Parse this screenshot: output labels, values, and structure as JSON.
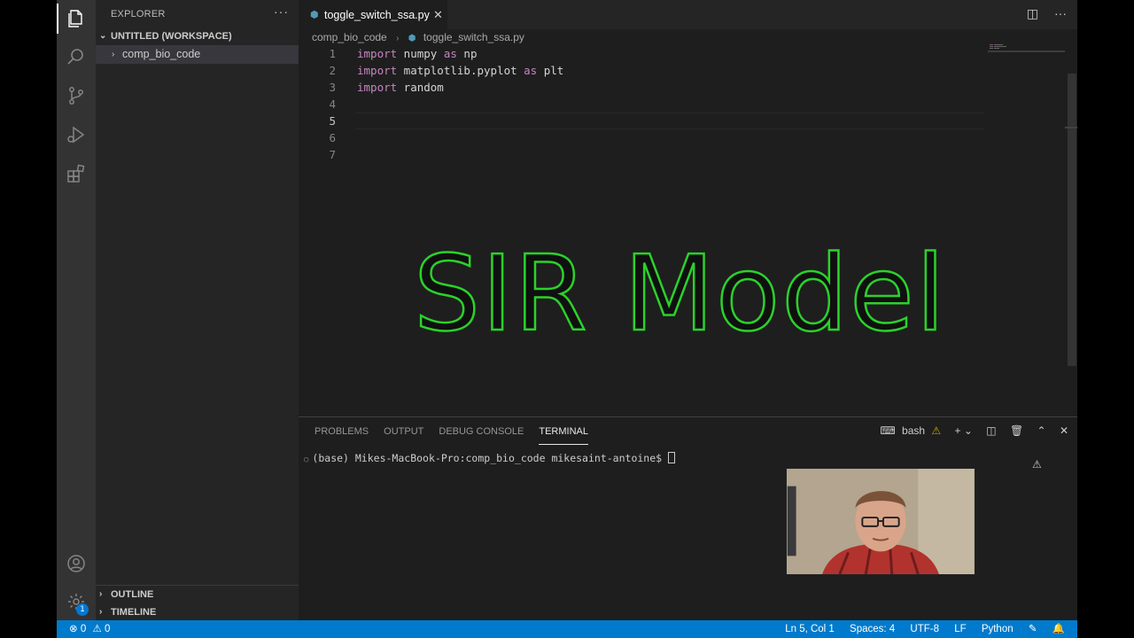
{
  "sidebar": {
    "title": "EXPLORER",
    "more": "···",
    "workspace_label": "UNTITLED (WORKSPACE)",
    "folder_label": "comp_bio_code",
    "outline_label": "OUTLINE",
    "timeline_label": "TIMELINE"
  },
  "activity": {
    "settings_badge": "1"
  },
  "editor": {
    "tab_label": "toggle_switch_ssa.py",
    "breadcrumb": {
      "folder": "comp_bio_code",
      "file": "toggle_switch_ssa.py"
    },
    "lines": [
      {
        "num": "1",
        "kw": "import",
        "rest1": " numpy ",
        "kw2": "as",
        "rest2": " np"
      },
      {
        "num": "2",
        "kw": "import",
        "rest1": " matplotlib.pyplot ",
        "kw2": "as",
        "rest2": " plt"
      },
      {
        "num": "3",
        "kw": "import",
        "rest1": " random",
        "kw2": "",
        "rest2": ""
      },
      {
        "num": "4",
        "kw": "",
        "rest1": "",
        "kw2": "",
        "rest2": ""
      },
      {
        "num": "5",
        "kw": "",
        "rest1": "",
        "kw2": "",
        "rest2": ""
      },
      {
        "num": "6",
        "kw": "",
        "rest1": "",
        "kw2": "",
        "rest2": ""
      },
      {
        "num": "7",
        "kw": "",
        "rest1": "",
        "kw2": "",
        "rest2": ""
      }
    ],
    "overlay_title": "SIR Model"
  },
  "panel": {
    "tabs": [
      "PROBLEMS",
      "OUTPUT",
      "DEBUG CONSOLE",
      "TERMINAL"
    ],
    "active_tab": "TERMINAL",
    "shell_label": "bash",
    "prompt": "(base) Mikes-MacBook-Pro:comp_bio_code mikesaint-antoine$ "
  },
  "status": {
    "errors": "0",
    "warnings": "0",
    "position": "Ln 5, Col 1",
    "spaces": "Spaces: 4",
    "encoding": "UTF-8",
    "eol": "LF",
    "language": "Python"
  },
  "colors": {
    "status_bar": "#007acc",
    "keyword": "#c586c0",
    "overlay_outline": "#2bd12b"
  }
}
